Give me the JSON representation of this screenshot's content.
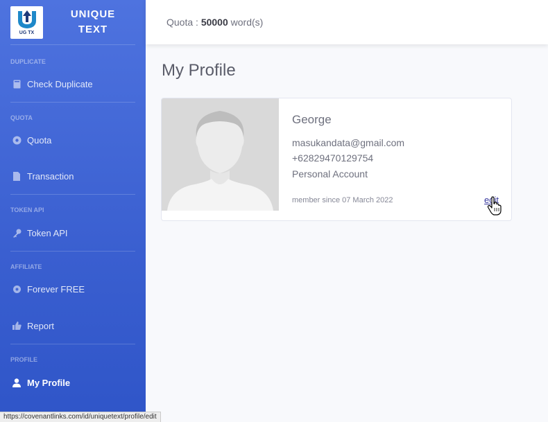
{
  "brand": {
    "name_line1": "UNIQUE",
    "name_line2": "TEXT",
    "logo_text": "UG TX"
  },
  "sidebar": {
    "sections": [
      {
        "heading": "DUPLICATE",
        "items": [
          {
            "label": "Check Duplicate",
            "icon": "book-icon"
          }
        ]
      },
      {
        "heading": "QUOTA",
        "items": [
          {
            "label": "Quota",
            "icon": "circle-icon"
          },
          {
            "label": "Transaction",
            "icon": "file-icon"
          }
        ]
      },
      {
        "heading": "TOKEN API",
        "items": [
          {
            "label": "Token API",
            "icon": "key-icon"
          }
        ]
      },
      {
        "heading": "AFFILIATE",
        "items": [
          {
            "label": "Forever FREE",
            "icon": "gear-icon"
          },
          {
            "label": "Report",
            "icon": "thumbs-up-icon"
          }
        ]
      },
      {
        "heading": "PROFILE",
        "items": [
          {
            "label": "My Profile",
            "icon": "user-icon",
            "active": true
          }
        ]
      }
    ]
  },
  "topbar": {
    "quota_label": "Quota :",
    "quota_value": "50000",
    "quota_unit": "word(s)"
  },
  "page": {
    "title": "My Profile"
  },
  "profile": {
    "name": "George",
    "email": "masukandata@gmail.com",
    "phone": "+62829470129754",
    "account_type": "Personal Account",
    "member_since": "member since 07 March 2022",
    "edit_label": "edit"
  },
  "statusbar": {
    "url": "https://covenantlinks.com/id/uniquetext/profile/edit"
  },
  "colors": {
    "sidebar_accent": "#4e73df",
    "link": "#3a3b9f"
  }
}
